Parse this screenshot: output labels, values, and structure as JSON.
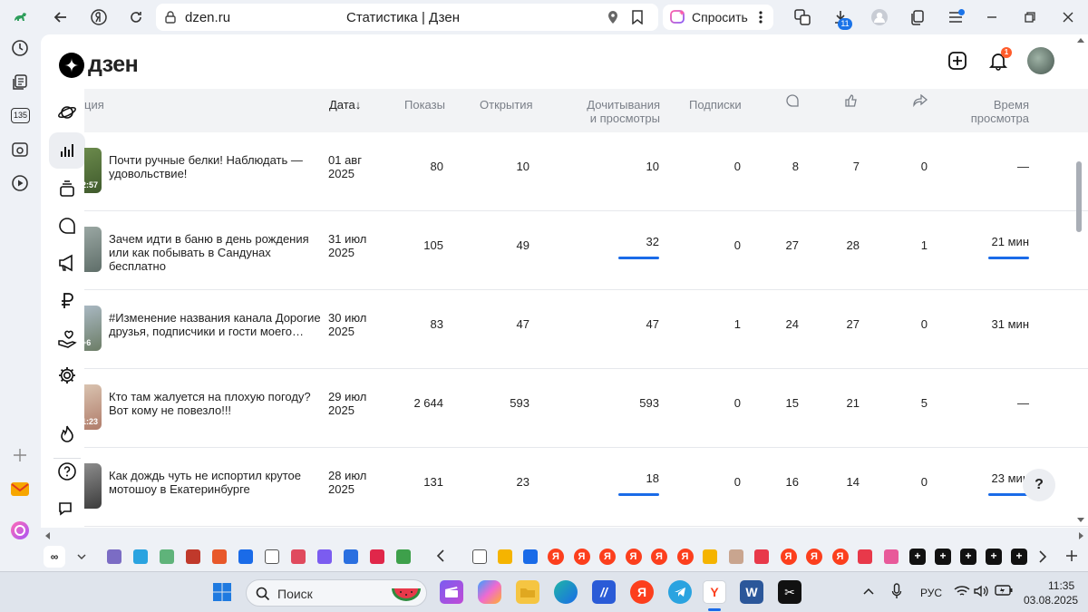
{
  "browser": {
    "domain": "dzen.ru",
    "tab_title": "Статистика | Дзен",
    "ask_label": "Спросить",
    "downloads_count": "11",
    "sidebar_badge": "135"
  },
  "header": {
    "logo_text": "дзен",
    "notification_count": "1"
  },
  "table": {
    "columns": {
      "publication": "ция",
      "date": "Дата",
      "sort_arrow": "↓",
      "impressions": "Показы",
      "opens": "Открытия",
      "reads_line1": "Дочитывания",
      "reads_line2": "и просмотры",
      "subscriptions": "Подписки",
      "time_line1": "Время",
      "time_line2": "просмотра"
    },
    "rows": [
      {
        "title": "Почти ручные белки! Наблюдать — удовольствие!",
        "date_line1": "01 авг",
        "date_line2": "2025",
        "thumb_label": "2:57",
        "impressions": "80",
        "opens": "10",
        "reads": "10",
        "reads_share": 0,
        "subscriptions": "0",
        "comments": "8",
        "likes": "7",
        "reposts": "0",
        "watch_time": "—",
        "watch_time_share": 0
      },
      {
        "title": "Зачем идти в баню в день рождения или как побывать в Сандунах бесплатно",
        "date_line1": "31 июл",
        "date_line2": "2025",
        "thumb_label": "",
        "impressions": "105",
        "opens": "49",
        "reads": "32",
        "reads_share": 1,
        "subscriptions": "0",
        "comments": "27",
        "likes": "28",
        "reposts": "1",
        "watch_time": "21 мин",
        "watch_time_share": 1
      },
      {
        "title": "#Изменение названия канала Дорогие друзья, подписчики и гости моего…",
        "date_line1": "30 июл",
        "date_line2": "2025",
        "thumb_label": "+6",
        "impressions": "83",
        "opens": "47",
        "reads": "47",
        "reads_share": 0,
        "subscriptions": "1",
        "comments": "24",
        "likes": "27",
        "reposts": "0",
        "watch_time": "31 мин",
        "watch_time_share": 0
      },
      {
        "title": "Кто там жалуется на плохую погоду?Вот кому не повезло!!!",
        "date_line1": "29 июл",
        "date_line2": "2025",
        "thumb_label": "1:23",
        "impressions": "2 644",
        "opens": "593",
        "reads": "593",
        "reads_share": 0,
        "subscriptions": "0",
        "comments": "15",
        "likes": "21",
        "reposts": "5",
        "watch_time": "—",
        "watch_time_share": 0
      },
      {
        "title": "Как дождь чуть не испортил крутое мотошоу в Екатеринбурге",
        "date_line1": "28 июл",
        "date_line2": "2025",
        "thumb_label": "",
        "impressions": "131",
        "opens": "23",
        "reads": "18",
        "reads_share": 1,
        "subscriptions": "0",
        "comments": "16",
        "likes": "14",
        "reposts": "0",
        "watch_time": "23 мин",
        "watch_time_share": 1
      }
    ]
  },
  "help_label": "?",
  "taskbar": {
    "search_label": "Поиск",
    "language": "РУС",
    "time": "11:35",
    "date": "03.08.2025"
  },
  "colors": {
    "accent": "#1a6be8",
    "yandex_red": "#fc3f1d",
    "badge_orange": "#ff5c2b"
  }
}
